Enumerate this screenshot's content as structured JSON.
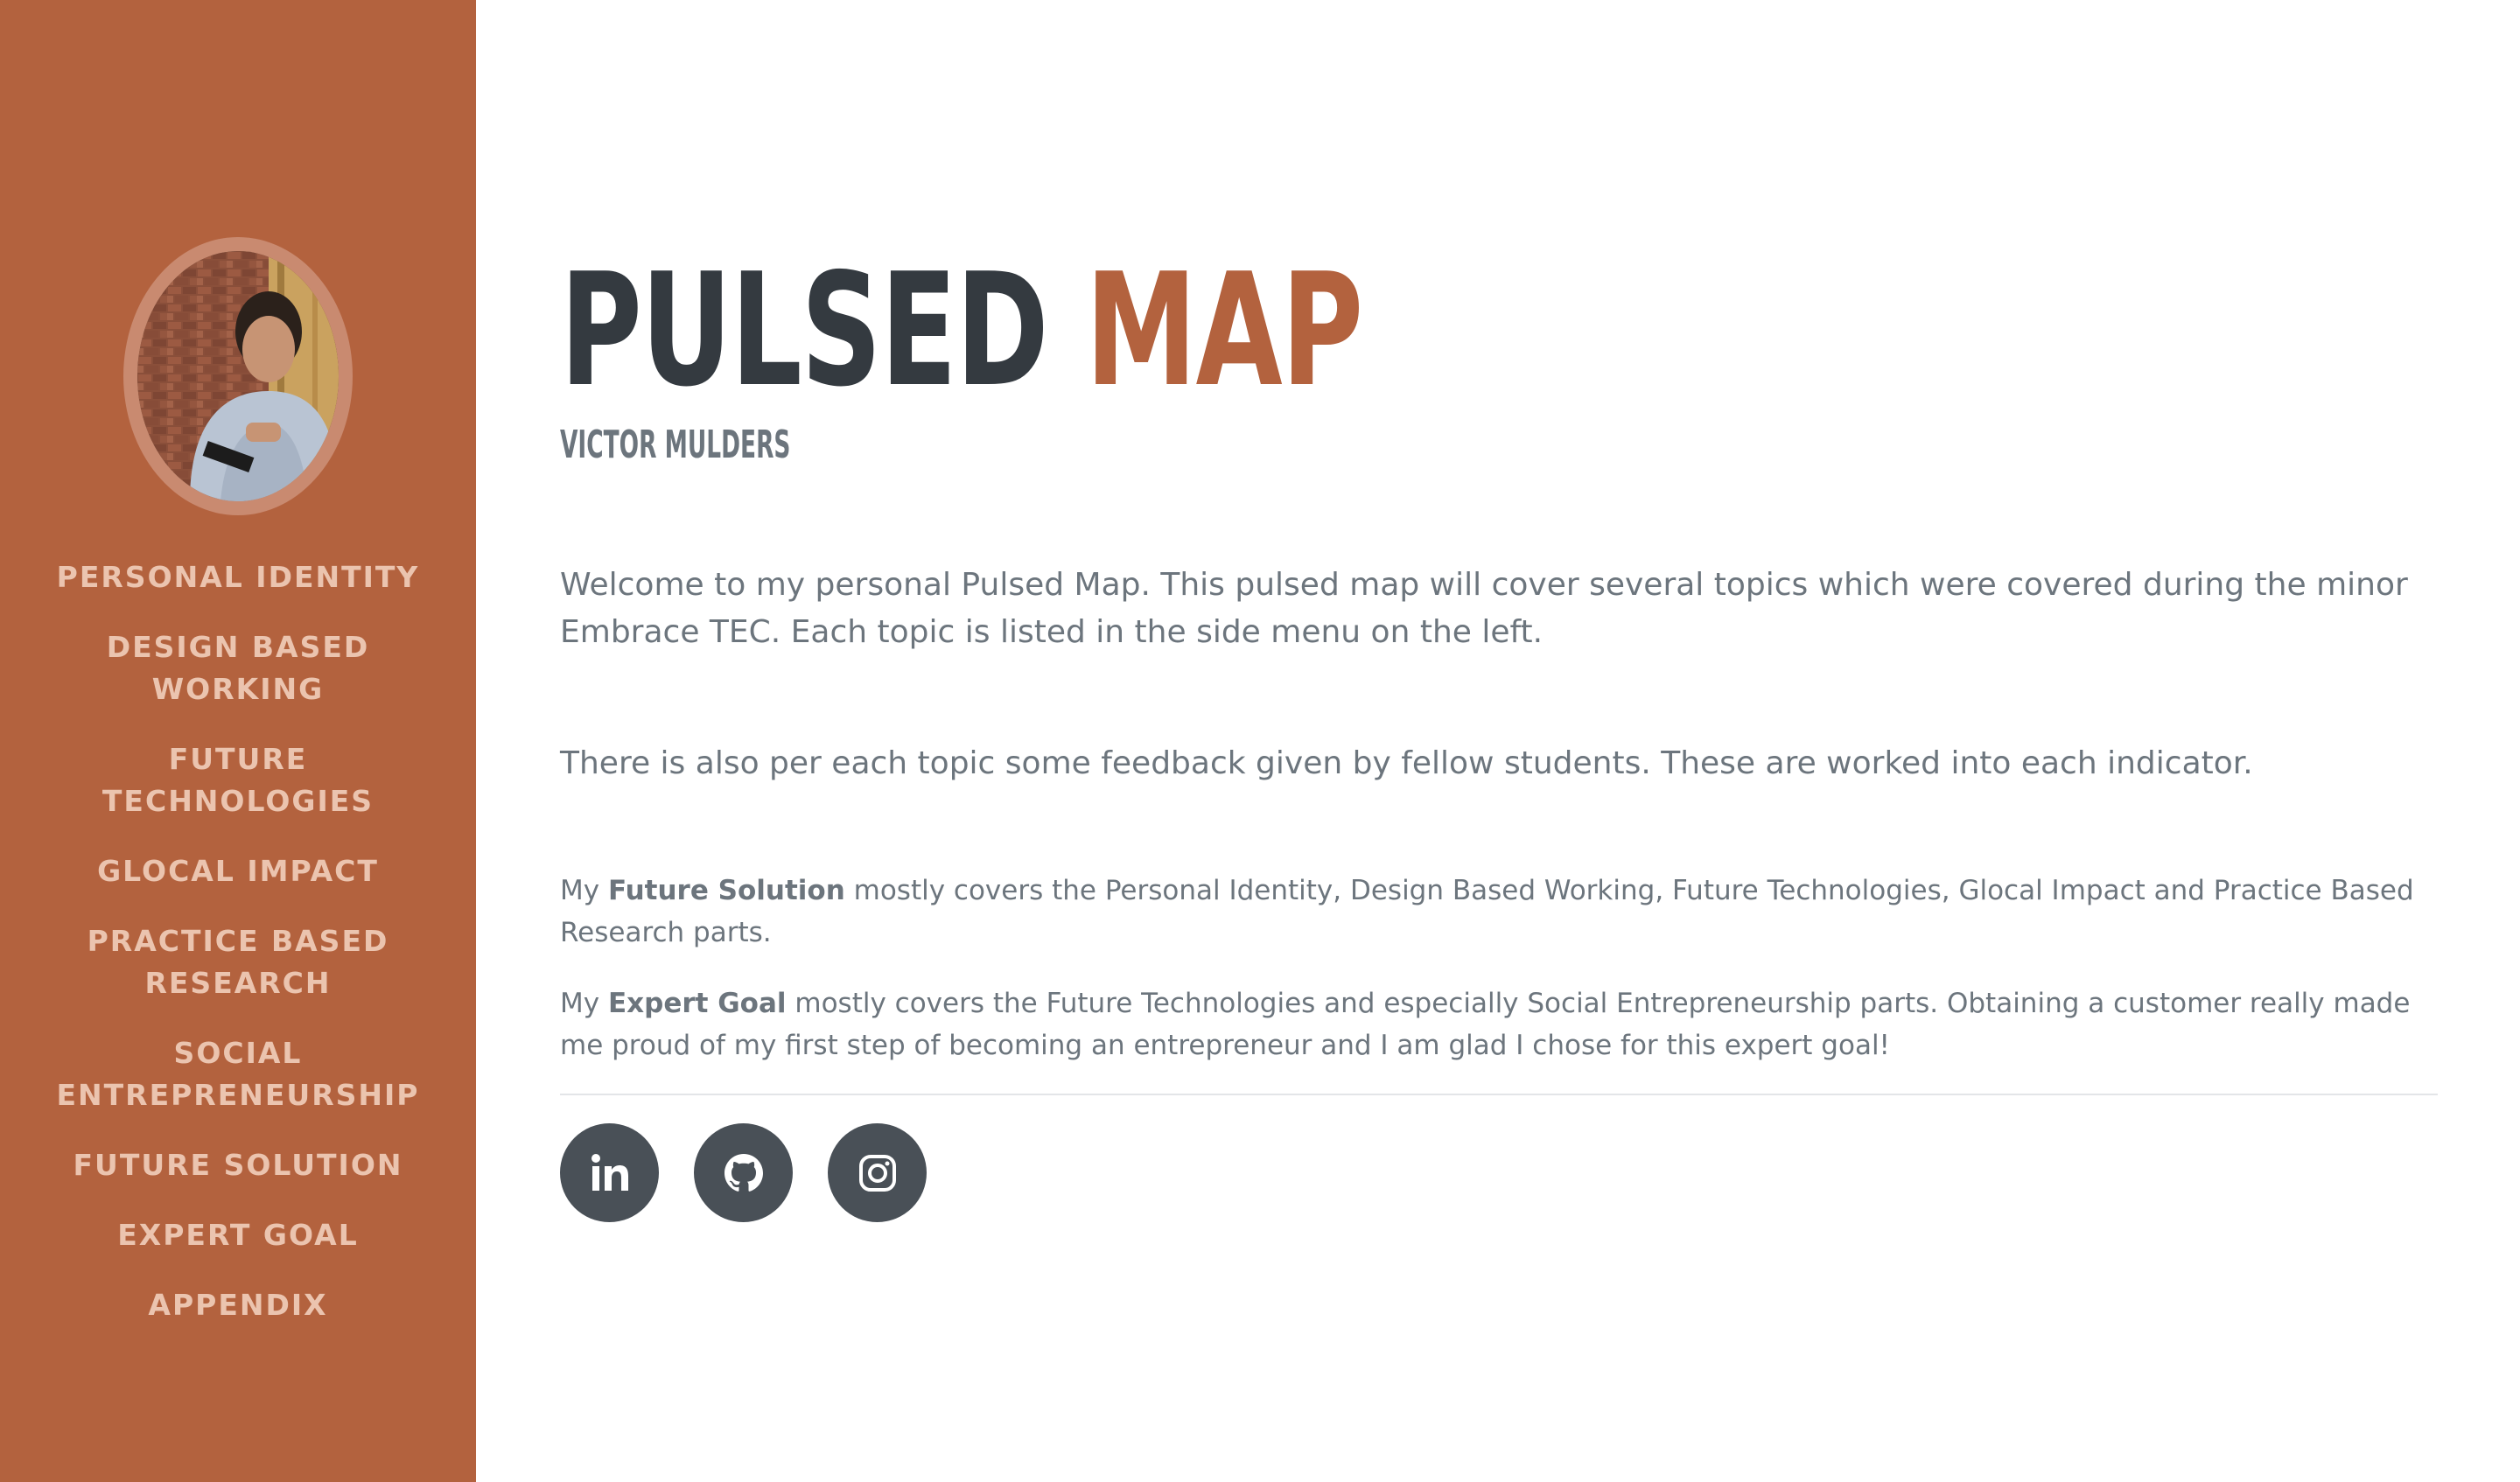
{
  "profile": {
    "photo_alt": "Victor Mulders profile photo"
  },
  "nav": {
    "items": [
      {
        "label": "PERSONAL IDENTITY"
      },
      {
        "label": "DESIGN BASED WORKING"
      },
      {
        "label": "FUTURE TECHNOLOGIES"
      },
      {
        "label": "GLOCAL IMPACT"
      },
      {
        "label": "PRACTICE BASED RESEARCH"
      },
      {
        "label": "SOCIAL ENTREPRENEURSHIP"
      },
      {
        "label": "FUTURE SOLUTION"
      },
      {
        "label": "EXPERT GOAL"
      },
      {
        "label": "APPENDIX"
      }
    ]
  },
  "header": {
    "title_part1": "PULSED",
    "title_part2": "MAP",
    "subtitle": "VICTOR MULDERS"
  },
  "content": {
    "lead1": "Welcome to my personal Pulsed Map. This pulsed map will cover several topics which were covered during the minor Embrace TEC. Each topic is listed in the side menu on the left.",
    "lead2": "There is also per each topic some feedback given by fellow students. These are worked into each indicator.",
    "p1_prefix": "My",
    "p1_bold": "Future Solution",
    "p1_rest": "mostly covers the Personal Identity, Design Based Working, Future Technologies, Glocal Impact and Practice Based Research parts.",
    "p2_prefix": "My",
    "p2_bold": "Expert Goal",
    "p2_rest": "mostly covers the Future Technologies and especially Social Entrepreneurship parts. Obtaining a customer really made me proud of my first step of becoming an entrepreneur and I am glad I chose for this expert goal!"
  },
  "social": [
    {
      "icon": "linkedin-icon"
    },
    {
      "icon": "github-icon"
    },
    {
      "icon": "instagram-icon"
    }
  ],
  "colors": {
    "accent": "#b3623e",
    "nav_text": "#ebc4af",
    "heading_dark": "#343a40",
    "muted_text": "#6c757d",
    "social_bg": "#495057"
  }
}
